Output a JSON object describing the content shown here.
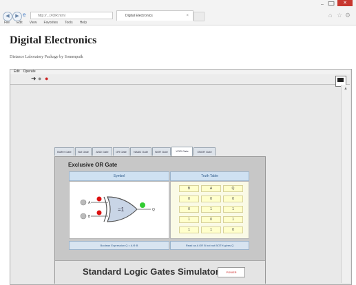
{
  "browser": {
    "address": "http://.../XOR.html",
    "tab_title": "Digital Electronics",
    "tab_close": "×",
    "menu": [
      "File",
      "Edit",
      "View",
      "Favorites",
      "Tools",
      "Help"
    ],
    "win_min": "–",
    "win_close": "✕"
  },
  "page": {
    "title": "Digital Electronics",
    "subtitle": "Distance Laboratory Package by Somenpaik"
  },
  "labview": {
    "menu": [
      "Edit",
      "Operate"
    ],
    "tools": [
      {
        "glyph": "➜",
        "color": "#333333"
      },
      {
        "glyph": "●",
        "color": "#888888"
      },
      {
        "glyph": "●",
        "color": "#cc2222"
      }
    ]
  },
  "gate_tabs": [
    {
      "label": "Buffer Gate",
      "active": false
    },
    {
      "label": "Not Gate",
      "active": false
    },
    {
      "label": "AND Gate",
      "active": false
    },
    {
      "label": "OR Gate",
      "active": false
    },
    {
      "label": "NAND Gate",
      "active": false
    },
    {
      "label": "NOR Gate",
      "active": false
    },
    {
      "label": "XOR Gate",
      "active": true
    },
    {
      "label": "XNOR Gate",
      "active": false
    }
  ],
  "simulator": {
    "gate_title": "Exclusive OR Gate",
    "symbol_header": "Symbol",
    "truth_table_header": "Truth Table",
    "gate_symbol_label": "=1",
    "input_a_label": "A",
    "input_b_label": "B",
    "output_label": "Q",
    "truth_table": {
      "headers": [
        "B",
        "A",
        "Q"
      ],
      "rows": [
        [
          "0",
          "0",
          "0"
        ],
        [
          "0",
          "1",
          "1"
        ],
        [
          "1",
          "0",
          "1"
        ],
        [
          "1",
          "1",
          "0"
        ]
      ]
    },
    "expression": "Boolean Expression Q = A ⊕ B",
    "reading": "Read as A OR B but not BOTH gives Q",
    "title": "Standard Logic Gates Simulator",
    "power_label": "POWER"
  },
  "colors": {
    "accent_blue": "#2e5a8a",
    "led_red": "#dd1111",
    "led_green": "#33cc33",
    "close_red": "#c7372f"
  }
}
